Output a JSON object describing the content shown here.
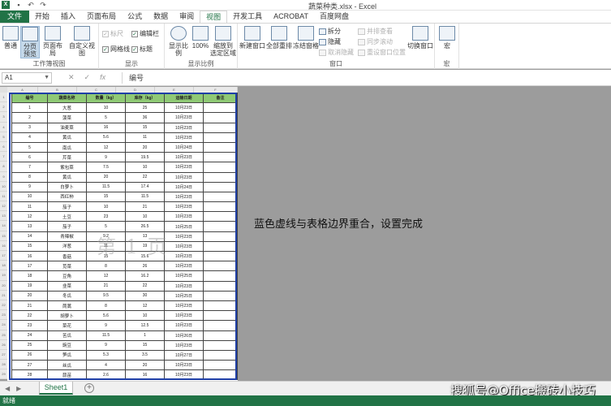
{
  "window": {
    "title": "蔬菜种类.xlsx - Excel"
  },
  "menu": {
    "tabs": [
      "文件",
      "开始",
      "插入",
      "页面布局",
      "公式",
      "数据",
      "审阅",
      "视图",
      "开发工具",
      "ACROBAT",
      "百度网盘"
    ]
  },
  "ribbon": {
    "workbook_views": {
      "group_label": "工作簿视图",
      "normal": "普通",
      "page_break_preview": "分页\n预览",
      "page_layout": "页面布局",
      "custom_views": "自定义视图"
    },
    "show": {
      "group_label": "显示",
      "ruler": "标尺",
      "formula_bar": "编辑栏",
      "gridlines": "网格线",
      "headings": "标题"
    },
    "zoom": {
      "group_label": "显示比例",
      "zoom": "显示比例",
      "hundred": "100%",
      "zoom_to_selection": "缩放到\n选定区域"
    },
    "window_group": {
      "group_label": "窗口",
      "new_window": "新建窗口",
      "arrange_all": "全部重排",
      "freeze_panes": "冻结窗格",
      "split": "拆分",
      "hide": "隐藏",
      "unhide": "取消隐藏",
      "view_side_by_side": "并排查看",
      "synchronous_scrolling": "同步滚动",
      "reset_window_position": "重设窗口位置",
      "switch_windows": "切换窗口"
    },
    "macros": {
      "group_label": "宏",
      "macros": "宏"
    }
  },
  "formula_bar": {
    "name_box": "A1",
    "formula": "编号",
    "cancel": "✕",
    "enter": "✓",
    "fx": "fx"
  },
  "sheet": {
    "columns": [
      "A",
      "B",
      "C",
      "D",
      "E",
      "F"
    ],
    "headers": [
      "编号",
      "蔬菜名称",
      "数量（kg）",
      "库存（kg）",
      "运输日期",
      "备注"
    ],
    "rows": [
      [
        "1",
        "大葱",
        "10",
        "25",
        "10月23日",
        ""
      ],
      [
        "2",
        "菠菜",
        "5",
        "36",
        "10月23日",
        ""
      ],
      [
        "3",
        "油麦菜",
        "16",
        "15",
        "10月23日",
        ""
      ],
      [
        "4",
        "黄瓜",
        "5.6",
        "11",
        "10月23日",
        ""
      ],
      [
        "5",
        "南瓜",
        "12",
        "20",
        "10月24日",
        ""
      ],
      [
        "6",
        "芹菜",
        "9",
        "19.5",
        "10月23日",
        ""
      ],
      [
        "7",
        "紫包菜",
        "7.5",
        "10",
        "10月23日",
        ""
      ],
      [
        "8",
        "黄瓜",
        "20",
        "22",
        "10月23日",
        ""
      ],
      [
        "9",
        "白萝卜",
        "11.5",
        "17.4",
        "10月24日",
        ""
      ],
      [
        "10",
        "西红柿",
        "15",
        "11.5",
        "10月23日",
        ""
      ],
      [
        "11",
        "茄子",
        "10",
        "21",
        "10月23日",
        ""
      ],
      [
        "12",
        "土豆",
        "23",
        "10",
        "10月23日",
        ""
      ],
      [
        "13",
        "茄子",
        "5",
        "26.5",
        "10月25日",
        ""
      ],
      [
        "14",
        "青辣椒",
        "9.2",
        "13",
        "10月23日",
        ""
      ],
      [
        "15",
        "洋葱",
        "11",
        "19",
        "10月23日",
        ""
      ],
      [
        "16",
        "香菇",
        "15",
        "15.6",
        "10月23日",
        ""
      ],
      [
        "17",
        "苋菜",
        "8",
        "26",
        "10月23日",
        ""
      ],
      [
        "18",
        "豆角",
        "12",
        "16.2",
        "10月25日",
        ""
      ],
      [
        "19",
        "韭菜",
        "21",
        "22",
        "10月23日",
        ""
      ],
      [
        "20",
        "冬瓜",
        "9.5",
        "30",
        "10月25日",
        ""
      ],
      [
        "21",
        "茼蒿",
        "8",
        "12",
        "10月23日",
        ""
      ],
      [
        "22",
        "胡萝卜",
        "5.6",
        "10",
        "10月23日",
        ""
      ],
      [
        "23",
        "菜花",
        "9",
        "12.5",
        "10月23日",
        ""
      ],
      [
        "24",
        "苦瓜",
        "11.5",
        "1",
        "10月26日",
        ""
      ],
      [
        "25",
        "豌豆",
        "9",
        "15",
        "10月23日",
        ""
      ],
      [
        "26",
        "笋瓜",
        "5.3",
        "3.5",
        "10月27日",
        ""
      ],
      [
        "27",
        "丝瓜",
        "4",
        "20",
        "10月23日",
        ""
      ],
      [
        "28",
        "蒜苗",
        "2.6",
        "16",
        "10月23日",
        ""
      ]
    ],
    "watermark": "第 1 页",
    "annotation": "蓝色虚线与表格边界重合，设置完成"
  },
  "tabs": {
    "sheets": [
      "Sheet1"
    ]
  },
  "status": {
    "text": "就绪"
  },
  "credit": "搜狐号@Office搬砖小技巧",
  "colors": {
    "accent": "#217346",
    "header_fill": "#8fc975",
    "page_border": "#1f3fa6"
  }
}
